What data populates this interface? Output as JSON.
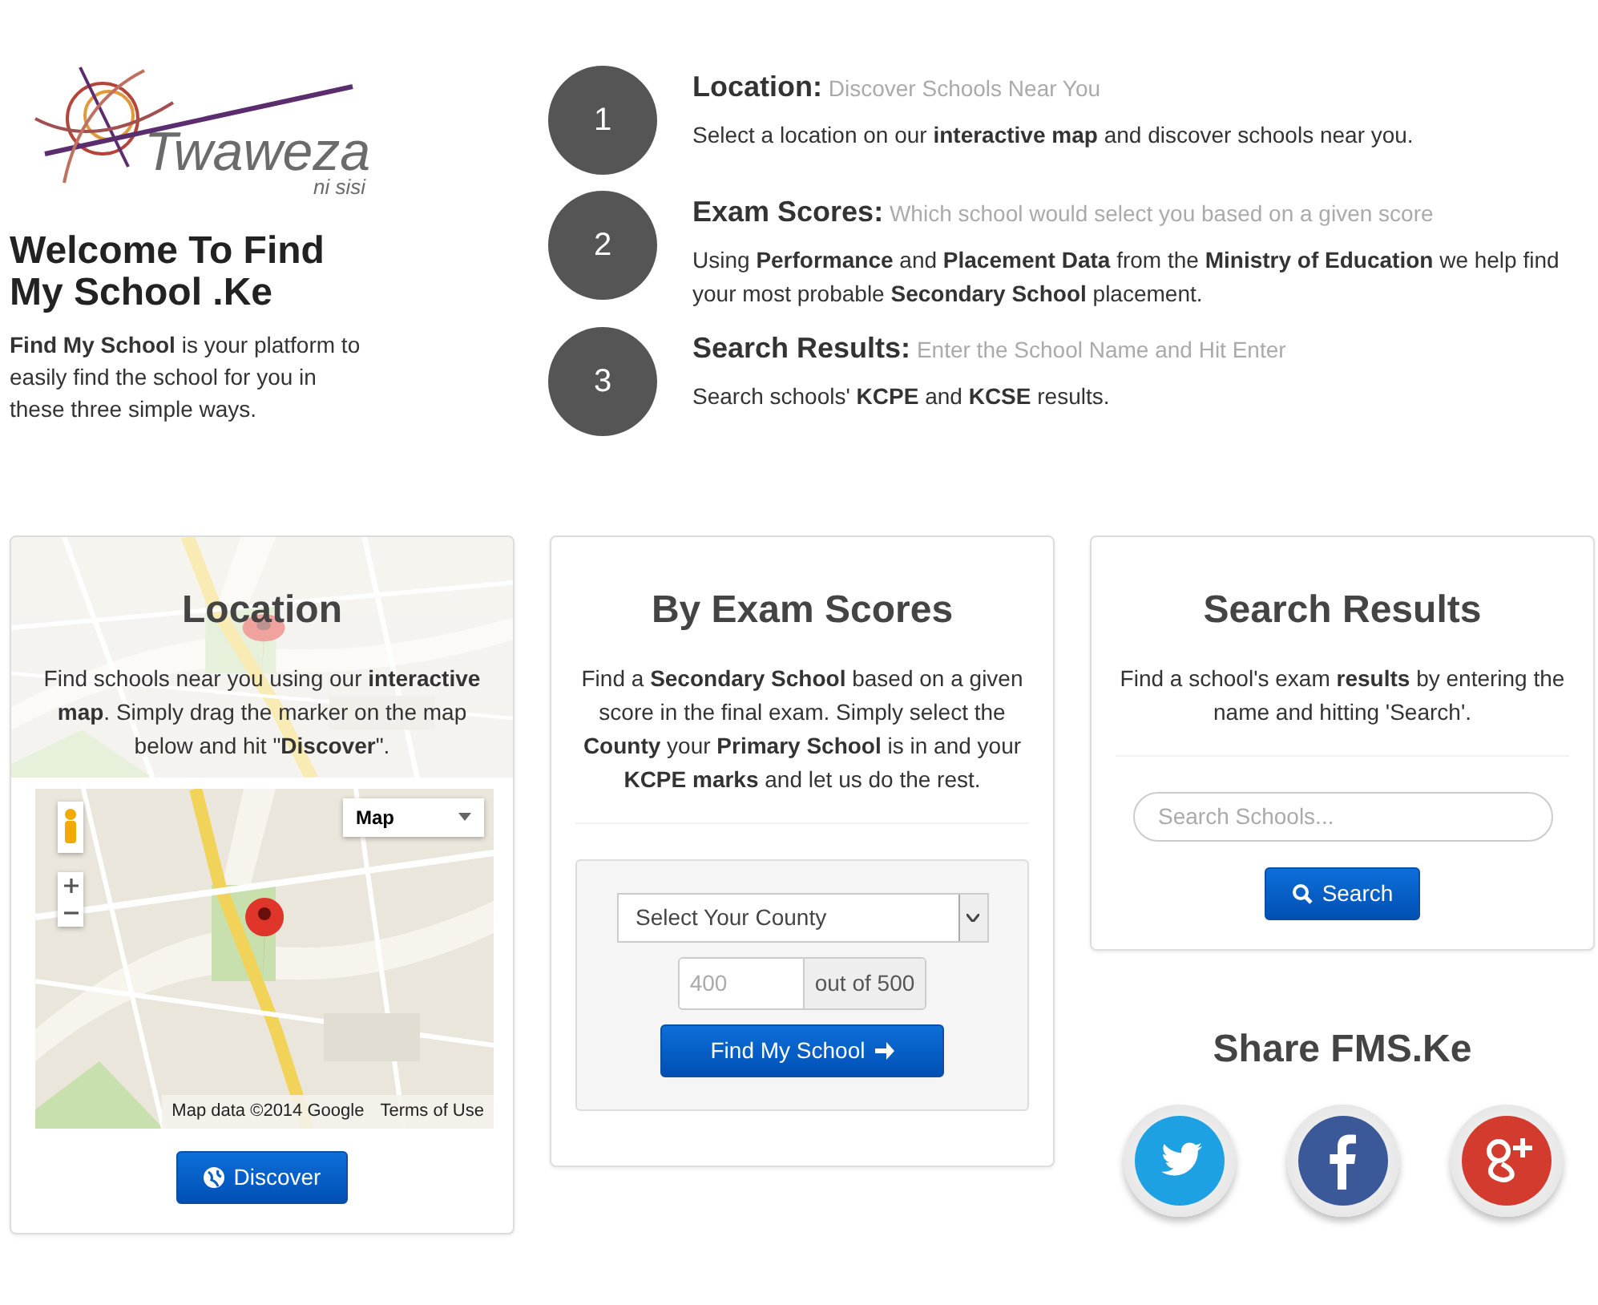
{
  "brand": {
    "name": "Twaweza",
    "tagline": "ni sisi"
  },
  "intro": {
    "title": "Welcome To Find My School .Ke",
    "text": "**Find My School** is your platform to easily find the school for you in these three simple ways."
  },
  "steps": [
    {
      "number": "1",
      "title": "Location:",
      "subtitle": "Discover Schools Near You",
      "text": "Select a location on our **interactive map** and discover schools near you."
    },
    {
      "number": "2",
      "title": "Exam Scores:",
      "subtitle": "Which school would select you based on a given score",
      "text": "Using **Performance** and **Placement Data** from the **Ministry of Education** we help find your most probable **Secondary School** placement."
    },
    {
      "number": "3",
      "title": "Search Results:",
      "subtitle": "Enter the School Name and Hit Enter",
      "text": "Search schools' **KCPE** and **KCSE** results."
    }
  ],
  "cards": [
    {
      "kind": "map",
      "title": "Location",
      "text": "Find schools near you using our **interactive map**. Simply drag the marker on the map below and hit \"**Discover**\".",
      "map": {
        "type_menu": "Map",
        "attribution": "Map data ©2014 Google",
        "terms": "Terms of Use"
      },
      "button": "Discover"
    },
    {
      "kind": "exam",
      "title": "By Exam Scores",
      "text": "Find a **Secondary School** based on a given score in the final exam. Simply select the **County** your **Primary School** is in and your **KCPE marks** and let us do the rest.",
      "county_select": "Select Your County",
      "marks_placeholder": "400",
      "marks_suffix": "out of 500",
      "button": "Find My School"
    },
    {
      "kind": "search",
      "title": "Search Results",
      "text": "Find a school's exam **results** by entering the name and hitting 'Search'.",
      "search_placeholder": "Search Schools...",
      "button": "Search"
    }
  ],
  "share": {
    "title": "Share FMS.Ke",
    "networks": [
      {
        "kind": "twitter"
      },
      {
        "kind": "facebook"
      },
      {
        "kind": "googleplus"
      }
    ]
  }
}
